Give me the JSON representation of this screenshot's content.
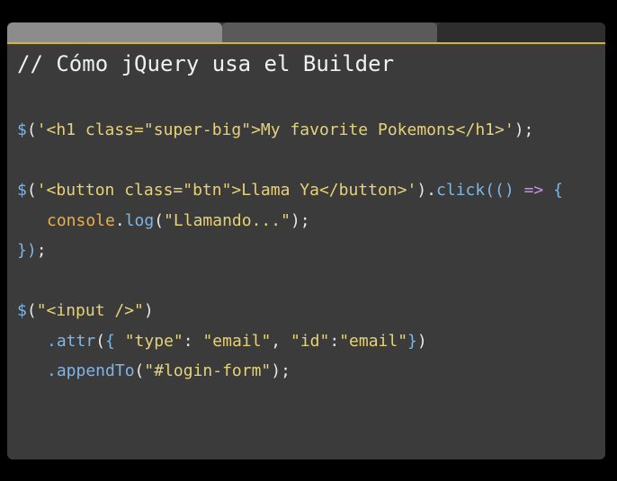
{
  "colors": {
    "background": "#3a3b3a",
    "accent": "#d4b03c",
    "string": "#e6d27a",
    "method": "#7fb6e6",
    "object": "#e8b04e",
    "arrow": "#c792ea"
  },
  "tabs": [
    {
      "label": ""
    },
    {
      "label": ""
    }
  ],
  "code": {
    "comment": "// Cómo jQuery usa el Builder",
    "line1": {
      "dollar": "$",
      "open": "(",
      "str": "'<h1 class=\"super-big\">My favorite Pokemons</h1>'",
      "close": ");"
    },
    "line2": {
      "dollar": "$",
      "open": "(",
      "str": "'<button class=\"btn\">Llama Ya</button>'",
      "close1": ").",
      "method": "click",
      "open2": "((",
      "close2": ") ",
      "arrow": "=>",
      "brace": " {"
    },
    "line3": {
      "obj": "console",
      "dot": ".",
      "method": "log",
      "open": "(",
      "str": "\"Llamando...\"",
      "close": ");"
    },
    "line4": {
      "brace": "})",
      "semi": ";"
    },
    "line5": {
      "dollar": "$",
      "open": "(",
      "str": "\"<input />\"",
      "close": ")"
    },
    "line6": {
      "method": ".attr",
      "open": "(",
      "brace_open": "{ ",
      "k1": "\"type\"",
      "colon1": ": ",
      "v1": "\"email\"",
      "comma": ", ",
      "k2": "\"id\"",
      "colon2": ":",
      "v2": "\"email\"",
      "brace_close": "}",
      "close": ")"
    },
    "line7": {
      "method": ".appendTo",
      "open": "(",
      "str": "\"#login-form\"",
      "close": ");"
    }
  }
}
